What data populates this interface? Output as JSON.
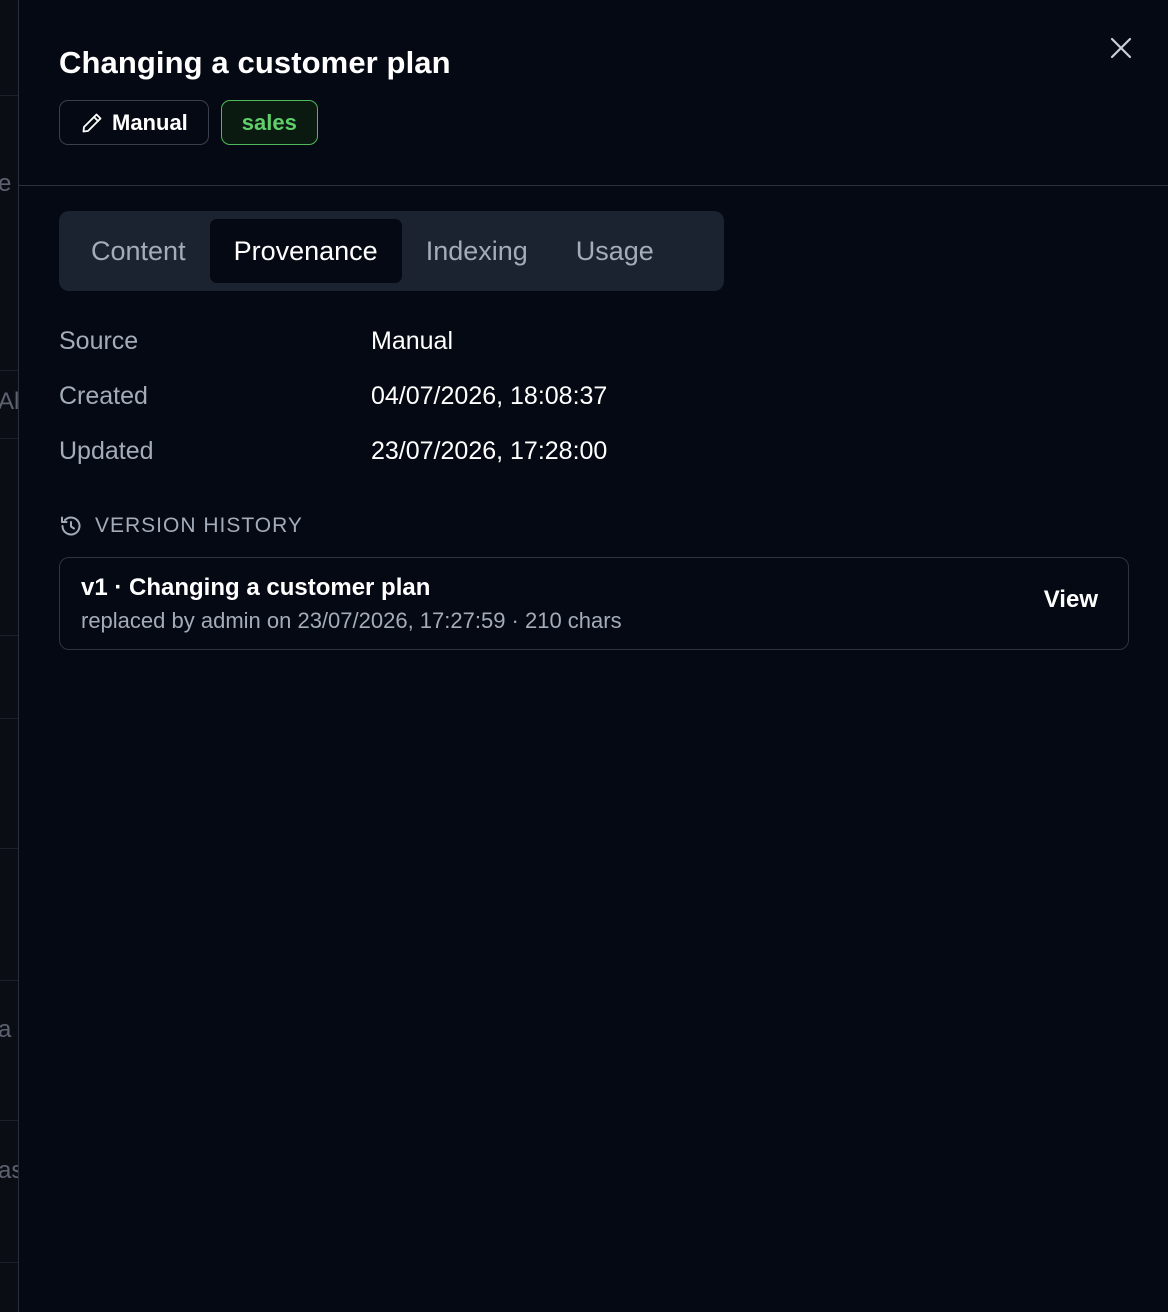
{
  "background_fragments": [
    "e",
    "Al",
    "a",
    "as"
  ],
  "header": {
    "title": "Changing a customer plan",
    "close_icon": "close-icon"
  },
  "badges": {
    "manual_label": "Manual",
    "manual_icon": "pencil-icon",
    "tag_label": "sales",
    "tag_color": "#5fcf6b"
  },
  "tabs": [
    {
      "label": "Content",
      "active": false
    },
    {
      "label": "Provenance",
      "active": true
    },
    {
      "label": "Indexing",
      "active": false
    },
    {
      "label": "Usage",
      "active": false
    }
  ],
  "provenance": {
    "source_label": "Source",
    "source_value": "Manual",
    "created_label": "Created",
    "created_value": "04/07/2026, 18:08:37",
    "updated_label": "Updated",
    "updated_value": "23/07/2026, 17:28:00"
  },
  "version_history": {
    "heading": "VERSION HISTORY",
    "heading_icon": "history-icon",
    "items": [
      {
        "title": "v1 · Changing a customer plan",
        "subtitle": "replaced by admin on 23/07/2026, 17:27:59 · 210 chars",
        "action_label": "View"
      }
    ]
  },
  "colors": {
    "background": "#050913",
    "tab_bar": "#1c2330",
    "muted_text": "#a4acb9",
    "tag_green": "#5fcf6b"
  }
}
